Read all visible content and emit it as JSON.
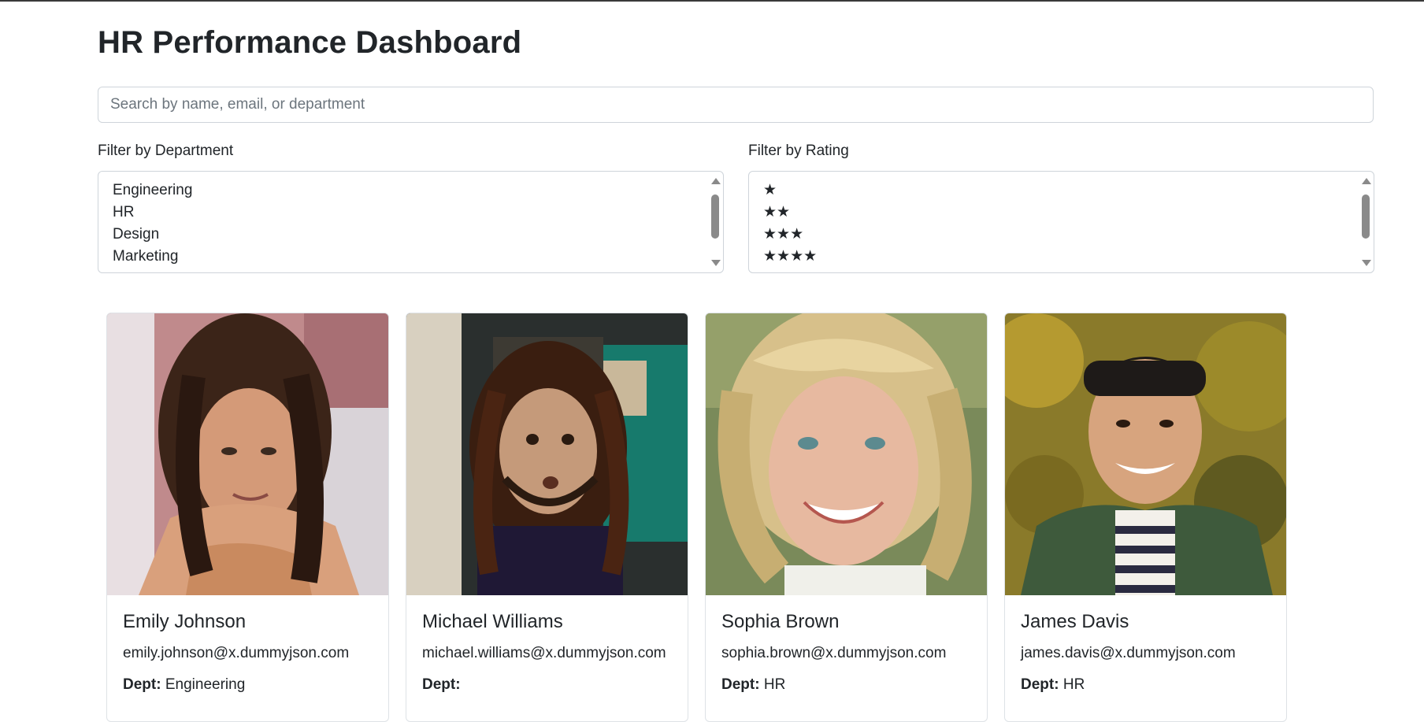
{
  "page": {
    "title": "HR Performance Dashboard"
  },
  "search": {
    "placeholder": "Search by name, email, or department",
    "value": ""
  },
  "filters": {
    "department": {
      "label": "Filter by Department",
      "options": [
        "Engineering",
        "HR",
        "Design",
        "Marketing"
      ]
    },
    "rating": {
      "label": "Filter by Rating",
      "options": [
        "★",
        "★★",
        "★★★",
        "★★★★"
      ]
    }
  },
  "employees": [
    {
      "name": "Emily Johnson",
      "email": "emily.johnson@x.dummyjson.com",
      "dept_label": "Dept:",
      "dept": "Engineering"
    },
    {
      "name": "Michael Williams",
      "email": "michael.williams@x.dummyjson.com",
      "dept_label": "Dept:",
      "dept": ""
    },
    {
      "name": "Sophia Brown",
      "email": "sophia.brown@x.dummyjson.com",
      "dept_label": "Dept:",
      "dept": "HR"
    },
    {
      "name": "James Davis",
      "email": "james.davis@x.dummyjson.com",
      "dept_label": "Dept:",
      "dept": "HR"
    }
  ]
}
